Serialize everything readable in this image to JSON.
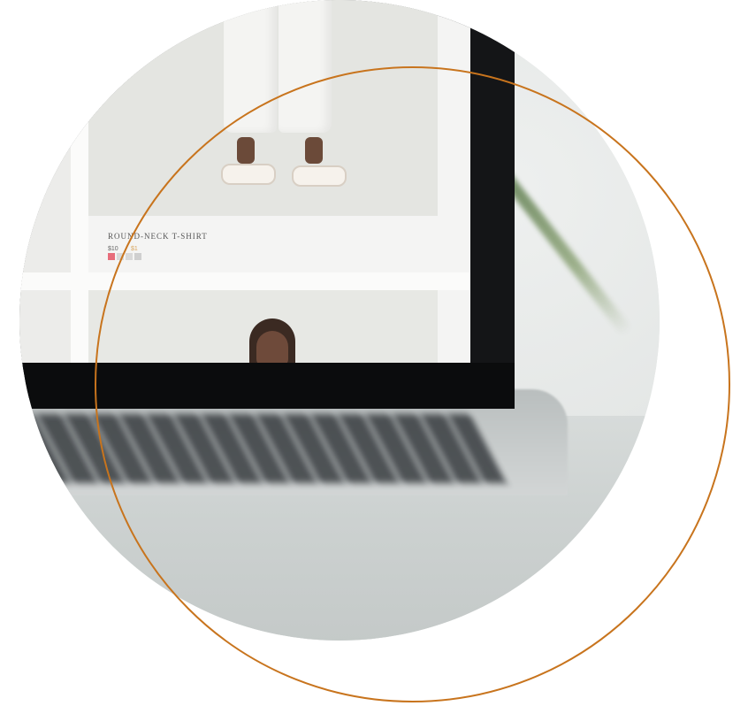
{
  "product": {
    "title": "ROUND-NECK T-SHIRT",
    "price": "$10",
    "price_old": "$1",
    "swatches": [
      "#e76d7b",
      "#d9d9d9",
      "#d9d9d9",
      "#cfcfcf"
    ]
  },
  "colors": {
    "ring": "#c8741d",
    "bezel": "#141517"
  }
}
